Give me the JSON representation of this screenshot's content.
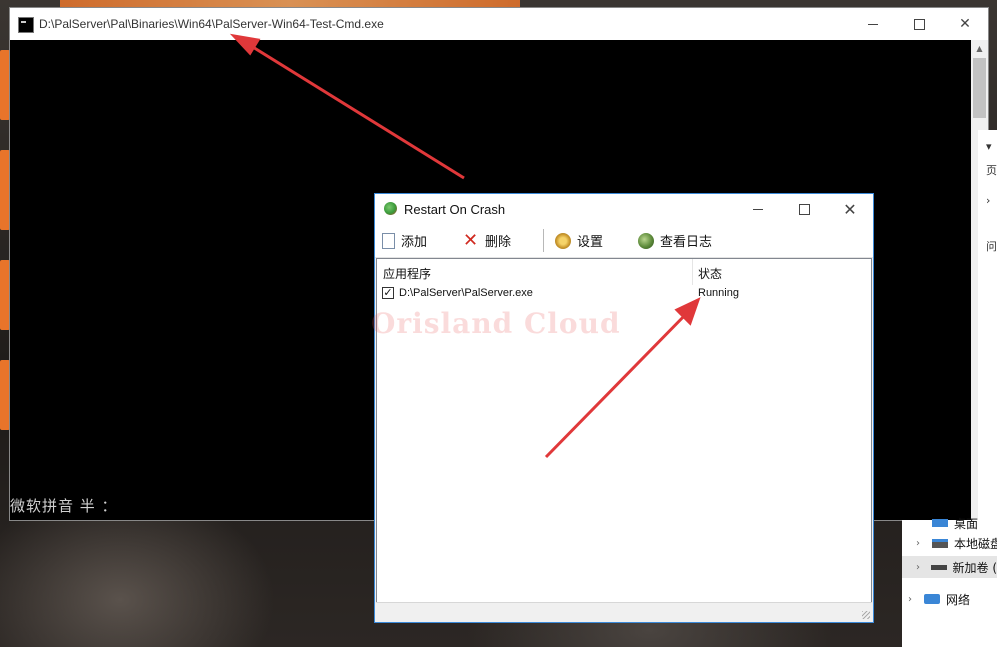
{
  "background": {
    "ime_indicator": "微软拼音 半 ：",
    "explorer_items": [
      {
        "label": "本地磁盘",
        "selected": false
      },
      {
        "label": "新加卷 (",
        "selected": true
      },
      {
        "label": "网络",
        "selected": false
      }
    ],
    "explorer_partial_top": "桌面",
    "side_strip_chars": [
      "页",
      "问"
    ]
  },
  "console_window": {
    "title": "D:\\PalServer\\Pal\\Binaries\\Win64\\PalServer-Win64-Test-Cmd.exe",
    "buttons": {
      "minimize": "minimize",
      "maximize": "maximize",
      "close": "close"
    }
  },
  "dialog": {
    "title": "Restart On Crash",
    "toolbar": {
      "add_label": "添加",
      "delete_label": "删除",
      "settings_label": "设置",
      "log_label": "查看日志"
    },
    "list": {
      "columns": [
        "应用程序",
        "状态"
      ],
      "rows": [
        {
          "app": "D:\\PalServer\\PalServer.exe",
          "status": "Running",
          "checked": true
        }
      ]
    },
    "watermark": "Orisland Cloud"
  },
  "colors": {
    "accent_border": "#3b8ad9",
    "annotation_arrow": "#e0383a",
    "delete_icon": "#d0291f"
  }
}
